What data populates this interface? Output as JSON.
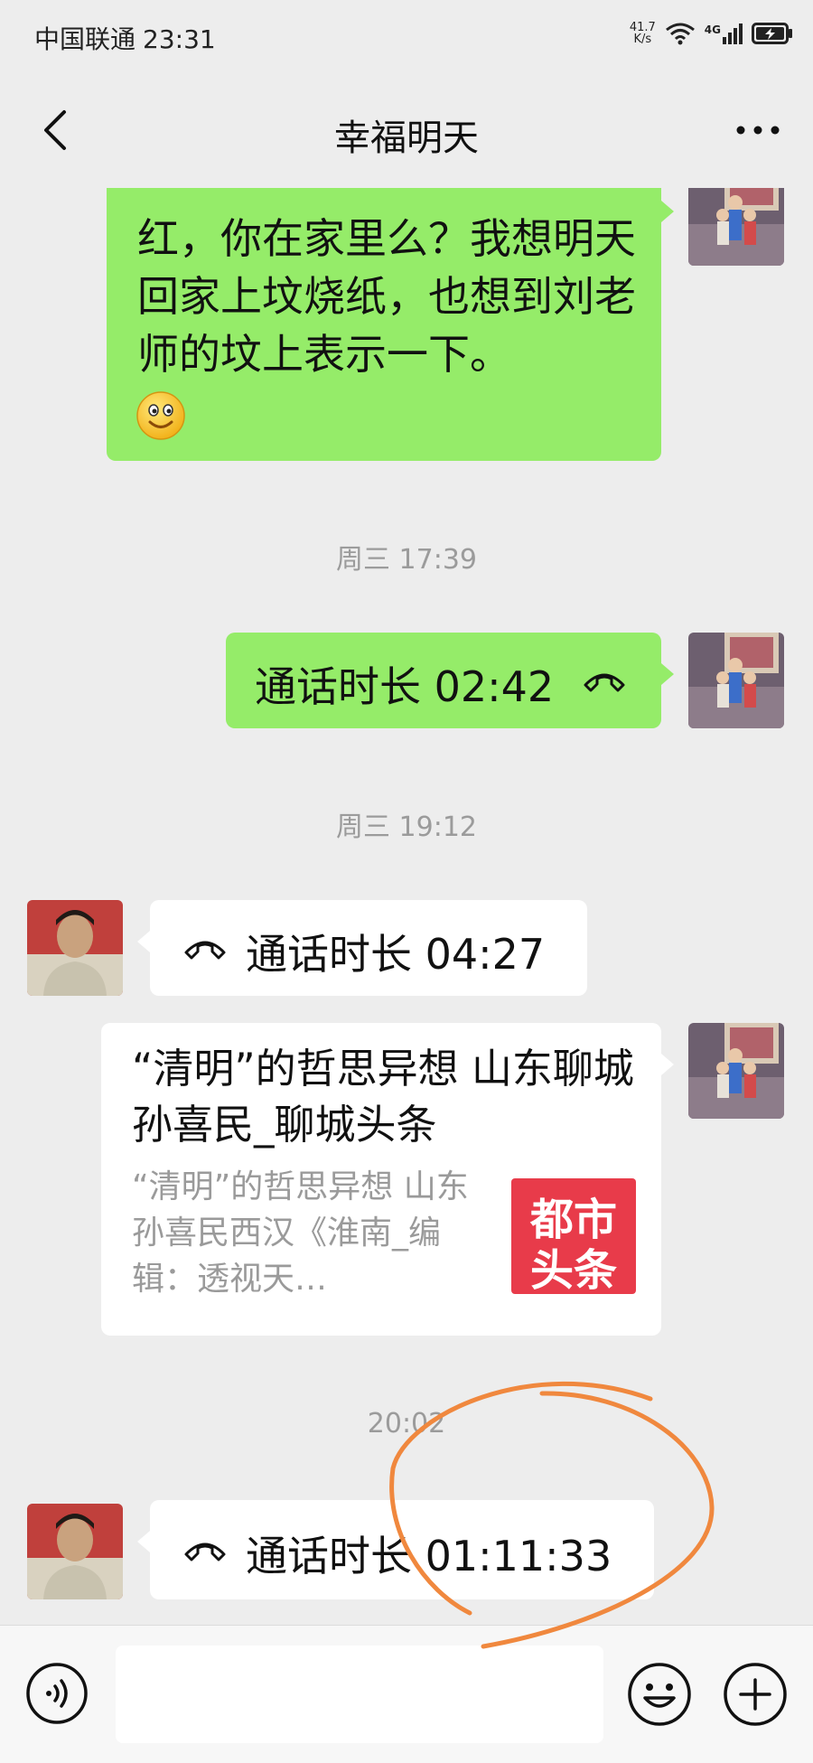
{
  "status_bar": {
    "carrier": "中国联通",
    "time": "23:31",
    "net_speed_value": "41.7",
    "net_speed_unit": "K/s",
    "network_type": "4G",
    "icons": [
      "wifi-icon",
      "signal-icon",
      "battery-charging-icon"
    ]
  },
  "header": {
    "title": "幸福明天",
    "back_icon": "chevron-left-icon",
    "more_icon": "more-dots-icon"
  },
  "messages": [
    {
      "type": "text",
      "side": "right",
      "text": "红，你在家里么？我想明天回家上坟烧纸，也想到刘老师的坟上表示一下。",
      "emoji": "😊"
    },
    {
      "type": "timestamp",
      "text": "周三 17:39"
    },
    {
      "type": "call",
      "side": "right",
      "label": "通话时长 02:42"
    },
    {
      "type": "timestamp",
      "text": "周三 19:12"
    },
    {
      "type": "call",
      "side": "left",
      "label": "通话时长 04:27"
    },
    {
      "type": "link",
      "side": "right",
      "title": "“清明”的哲思异想  山东聊城 孙喜民_聊城头条",
      "description": "“清明”的哲思异想 山东孙喜民西汉《淮南_编辑：透视天…",
      "logo_line1": "都市",
      "logo_line2": "头条"
    },
    {
      "type": "timestamp",
      "text": "20:02"
    },
    {
      "type": "call",
      "side": "left",
      "label": "通话时长 01:11:33"
    }
  ],
  "input_bar": {
    "placeholder": "",
    "voice_icon": "voice-icon",
    "emoji_icon": "emoji-icon",
    "plus_icon": "plus-icon"
  },
  "colors": {
    "background": "#ededed",
    "sent_bubble": "#95ec69",
    "received_bubble": "#ffffff",
    "annotation": "#f0883e",
    "logo_red": "#e83b4a"
  }
}
